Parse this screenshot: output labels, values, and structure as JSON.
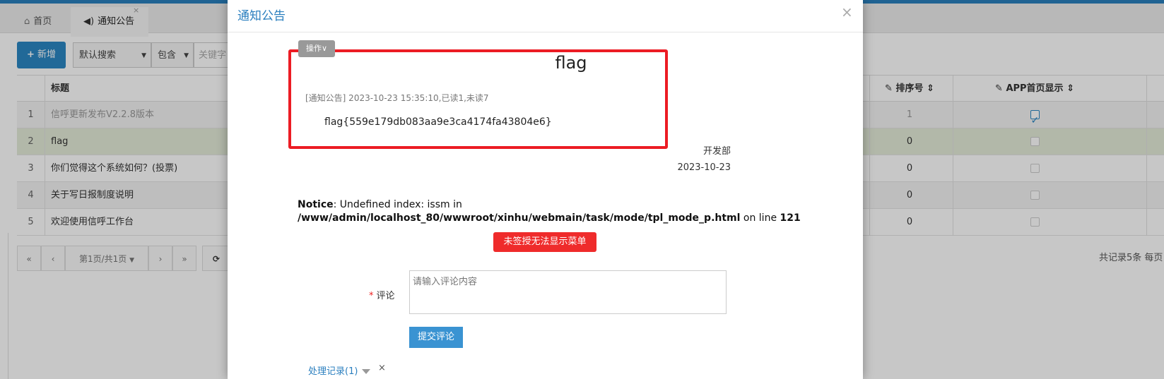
{
  "tabs": {
    "home": "首页",
    "notice": "通知公告",
    "close": "×"
  },
  "toolbar": {
    "add_label": "新增",
    "search_mode": "默认搜索",
    "match_mode": "包含",
    "keyword_placeholder": "关键字"
  },
  "grid": {
    "headers": {
      "title": "标题",
      "sort": "排序号",
      "app": "APP首页显示"
    },
    "rows": [
      {
        "index": "1",
        "title": "信呼更新发布V2.2.8版本",
        "sort": "1",
        "app_checked": true
      },
      {
        "index": "2",
        "title": "flag",
        "sort": "0",
        "app_checked": false
      },
      {
        "index": "3",
        "title": "你们觉得这个系统如何？(投票)",
        "sort": "0",
        "app_checked": false
      },
      {
        "index": "4",
        "title": "关于写日报制度说明",
        "sort": "0",
        "app_checked": false
      },
      {
        "index": "5",
        "title": "欢迎使用信呼工作台",
        "sort": "0",
        "app_checked": false
      }
    ]
  },
  "pager": {
    "first": "«",
    "prev": "‹",
    "page": "第1页/共1页",
    "next": "›",
    "last": "»",
    "refresh": "⟳",
    "info": "共记录5条  每页"
  },
  "modal": {
    "title": "通知公告",
    "close": "×",
    "op_badge": "操作∨",
    "notice_title": "flag",
    "notice_meta": "[通知公告] 2023-10-23 15:35:10,已读1,未读7",
    "notice_body": "flag{559e179db083aa9e3ca4174fa43804e6}",
    "dept": "开发部",
    "date": "2023-10-23",
    "php_notice": {
      "label": "Notice",
      "message": ": Undefined index: issm in",
      "path": "/www/admin/localhost_80/wwwroot/xinhu/webmain/task/mode/tpl_mode_p.html",
      "on_line": " on line ",
      "line": "121"
    },
    "unsigned_button": "未签授无法显示菜单",
    "comment": {
      "label": "评论",
      "required_mark": "*",
      "placeholder": "请输入评论内容",
      "submit": "提交评论"
    },
    "log_link": "处理记录(1)",
    "log_close": "×"
  },
  "colors": {
    "accent": "#2b7fbf",
    "highlight_border": "#ec1c24",
    "danger_button": "#ef2b2b",
    "selected_row": "#e5ecd9"
  }
}
